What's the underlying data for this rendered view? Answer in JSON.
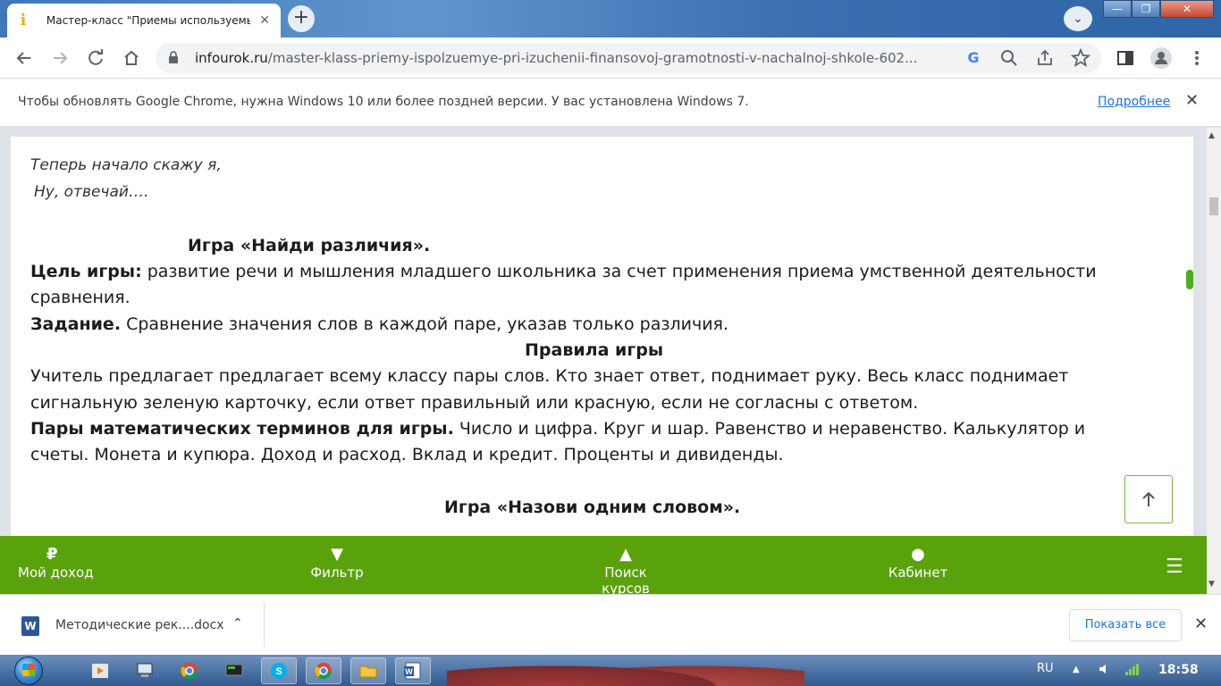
{
  "browser": {
    "tab_title": "Мастер-класс \"Приемы используемые при изучении финансовой грамотности\"",
    "tab_close": "✕",
    "new_tab": "+",
    "tab_menu": "⌄",
    "url_host": "infourok.ru",
    "url_path": "/master-klass-priemy-ispolzuemye-pri-izuchenii-finansovoj-gramotnosti-v-nachalnoj-shkole-602...",
    "window_min": "—",
    "window_max": "❐",
    "window_close": "✕"
  },
  "infobar": {
    "message": "Чтобы обновлять Google Chrome, нужна Windows 10 или более поздней версии. У вас установлена Windows 7.",
    "link": "Подробнее",
    "close": "✕"
  },
  "content": {
    "poem_line1": "Теперь начало скажу я,",
    "poem_line2": "Ну, отвечай….",
    "game1_title": "Игра «Найди различия».",
    "goal_label": "Цель игры:",
    "goal_text_1": " развитие речи и мышления младшего школьника за счет применения приема умственной деятельности",
    "goal_text_2": "сравнения.",
    "task_label": "Задание.",
    "task_text": " Сравнение значения слов в каждой паре, указав только различия.",
    "rules_title": "Правила игры",
    "rules_text_1": "   Учитель предлагает предлагает всему классу пары слов. Кто знает ответ, поднимает руку. Весь класс поднимает",
    "rules_text_2": "сигнальную зеленую карточку, если ответ правильный или красную, если не согласны с ответом.",
    "pairs_label": "Пары математических терминов для игры.",
    "pairs_text_1": "  Число и цифра. Круг и шар. Равенство и неравенство. Калькулятор и",
    "pairs_text_2": "счеты. Монета и купюра. Доход и расход. Вклад и кредит. Проценты и дивиденды.",
    "game2_title": "Игра «Назови одним словом»."
  },
  "bottom_nav": {
    "items": [
      {
        "label": "Мой доход",
        "icon": "ruble-icon",
        "glyph": "₽"
      },
      {
        "label": "Фильтр",
        "icon": "filter-icon",
        "glyph": "▼"
      },
      {
        "label": "Поиск курсов",
        "icon": "graduation-cap-icon",
        "glyph": "▲"
      },
      {
        "label": "Кабинет",
        "icon": "user-icon",
        "glyph": "●"
      }
    ],
    "menu_glyph": "☰"
  },
  "downloads": {
    "file_name": "Методические рек....docx",
    "file_badge": "W",
    "chevron": "⌃",
    "show_all": "Показать все",
    "close": "✕"
  },
  "taskbar": {
    "language": "RU",
    "time": "18:58"
  },
  "colors": {
    "accent_green": "#5aa20c",
    "link_blue": "#1a73e8"
  }
}
